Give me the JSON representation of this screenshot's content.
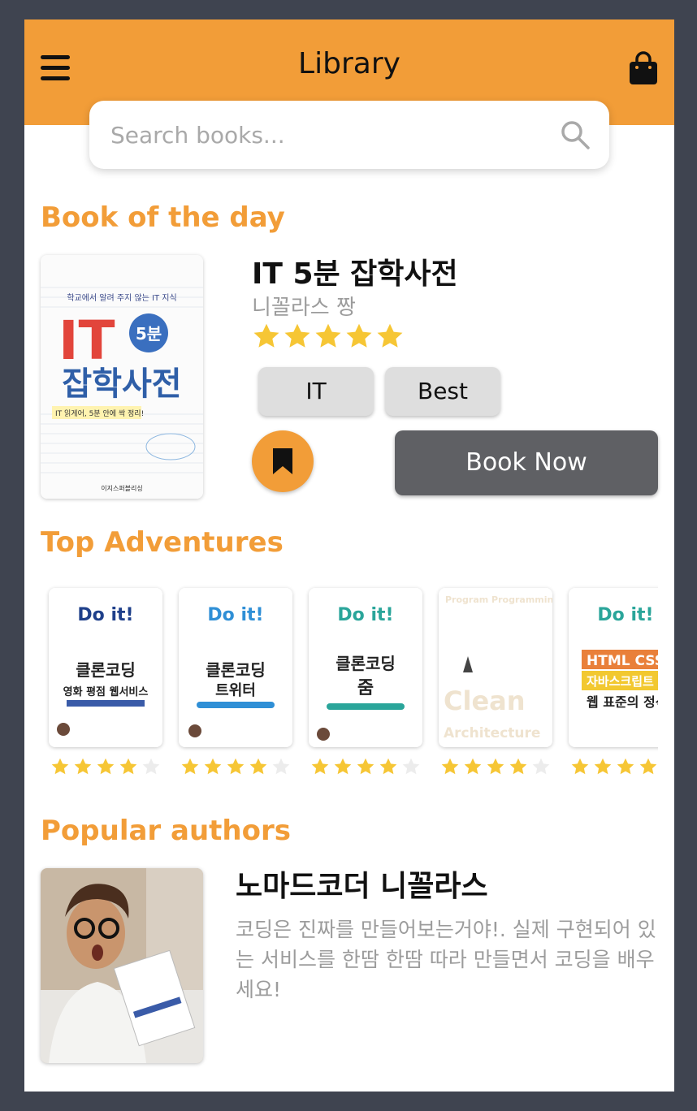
{
  "header": {
    "title": "Library",
    "menu_icon": "hamburger-menu-icon",
    "cart_icon": "shopping-bag-icon",
    "accent_color": "#f29d38"
  },
  "search": {
    "placeholder": "Search books...",
    "icon": "search-icon"
  },
  "book_of_the_day": {
    "section_title": "Book of the day",
    "title": "IT 5분 잡학사전",
    "author": "니꼴라스 짱",
    "rating": 5,
    "rating_max": 5,
    "tags": [
      "IT",
      "Best"
    ],
    "bookmark_icon": "bookmark-icon",
    "book_now_label": "Book Now",
    "cover": {
      "top_text": "학교에서 알려 주지 않는 IT 지식",
      "big_text": "IT",
      "badge_text": "5분",
      "title_text": "잡학사전",
      "subtitle_text": "IT 읽게어, 5분 안에 싹 정리!",
      "publisher_text": "이지스퍼블리싱"
    }
  },
  "top_adventures": {
    "section_title": "Top Adventures",
    "items": [
      {
        "cover_label": "Do it!",
        "cover_title": "클론코딩",
        "cover_subtitle": "영화 평점 웹서비스",
        "rating": 4,
        "rating_max": 5
      },
      {
        "cover_label": "Do it!",
        "cover_title": "클론코딩",
        "cover_subtitle": "트위터",
        "rating": 4,
        "rating_max": 5
      },
      {
        "cover_label": "Do it!",
        "cover_title": "클론코딩",
        "cover_subtitle": "줌",
        "rating": 4,
        "rating_max": 5
      },
      {
        "cover_label": "Program Programming Programmer",
        "cover_title": "Clean",
        "cover_subtitle": "Architecture",
        "rating": 4,
        "rating_max": 5
      },
      {
        "cover_label": "Do it!",
        "cover_title": "HTML CSS",
        "cover_subtitle": "자바스크립트",
        "extra_text": "웹 표준의 정석",
        "rating": 4,
        "rating_max": 5
      }
    ]
  },
  "popular_authors": {
    "section_title": "Popular authors",
    "name": "노마드코더 니꼴라스",
    "bio": "코딩은 진짜를 만들어보는거야!. 실제 구현되어 있는 서비스를 한땀 한땀 따라 만들면서 코딩을 배우세요!"
  }
}
